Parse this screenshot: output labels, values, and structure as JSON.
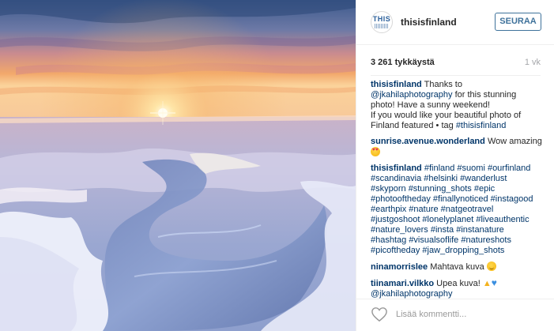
{
  "post": {
    "username": "thisisfinland",
    "follow_label": "SEURAA",
    "avatar_text": "THIS"
  },
  "stats": {
    "likes": "3 261 tykkäystä",
    "time": "1 vk"
  },
  "comments": [
    {
      "user": "thisisfinland",
      "lines": [
        {
          "pre": "",
          "mention": "@jkahilaphotography",
          "post": " for this stunning"
        },
        {
          "text": "photo! Have a sunny weekend!"
        },
        {
          "text": "If you would like your beautiful photo of"
        },
        {
          "pre": "Finland featured • tag ",
          "mention": "#thisisfinland",
          "post": ""
        }
      ],
      "first_text": "Thanks to"
    },
    {
      "user": "sunrise.avenue.wonderland",
      "text": "Wow amazing"
    },
    {
      "user": "thisisfinland",
      "hashtag_lines": [
        "#finland #suomi #ourfinland",
        "#scandinavia #helsinki #wanderlust",
        "#skyporn #stunning_shots #epic",
        "#photooftheday #finallynoticed #instagood",
        "#earthpix #nature #natgeotravel",
        "#justgoshoot #lonelyplanet #liveauthentic",
        "#nature_lovers #insta #instanature",
        "#hashtag #visualsoflife #natureshots",
        "#picoftheday #jaw_dropping_shots"
      ]
    },
    {
      "user": "ninamorrislee",
      "text": "Mahtava kuva"
    },
    {
      "user": "tiinamari.vilkko",
      "text": "Upea kuva!",
      "mention": "@jkahilaphotography"
    }
  ],
  "footer": {
    "comment_placeholder": "Lisää kommentti..."
  },
  "icons": {
    "like": "heart-outline-icon",
    "emoji1": "heart-eyes-emoji-icon",
    "emoji2": "smile-emoji-icon",
    "emoji3": "thumbs-up-emoji-icon",
    "emoji4": "blue-heart-emoji-icon"
  },
  "colors": {
    "accent": "#3f729b",
    "link": "#003569",
    "muted": "#a5a7aa"
  }
}
